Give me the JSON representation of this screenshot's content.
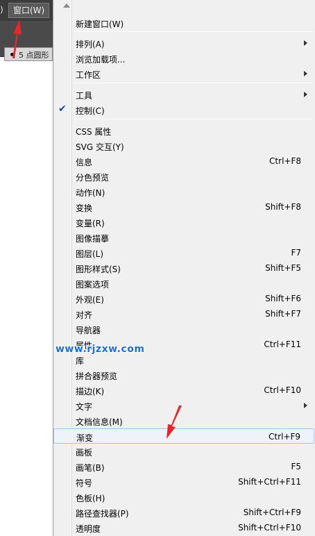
{
  "menubar": {
    "left_fragment": ")",
    "window_menu_label": "窗口(W)"
  },
  "toolbar": {
    "brush_label": "5 点圆形"
  },
  "menu": {
    "items": [
      {
        "label": "新建窗口(W)",
        "shortcut": "",
        "submenu": false
      },
      {
        "label": "排列(A)",
        "shortcut": "",
        "submenu": true
      },
      {
        "label": "浏览加载项...",
        "shortcut": "",
        "submenu": false
      },
      {
        "label": "工作区",
        "shortcut": "",
        "submenu": true
      },
      {
        "label": "工具",
        "shortcut": "",
        "submenu": true
      },
      {
        "label": "控制(C)",
        "shortcut": "",
        "submenu": false,
        "checked": true
      },
      {
        "label": "CSS 属性",
        "shortcut": "",
        "submenu": false
      },
      {
        "label": "SVG 交互(Y)",
        "shortcut": "",
        "submenu": false
      },
      {
        "label": "信息",
        "shortcut": "Ctrl+F8",
        "submenu": false
      },
      {
        "label": "分色预览",
        "shortcut": "",
        "submenu": false
      },
      {
        "label": "动作(N)",
        "shortcut": "",
        "submenu": false
      },
      {
        "label": "变换",
        "shortcut": "Shift+F8",
        "submenu": false
      },
      {
        "label": "变量(R)",
        "shortcut": "",
        "submenu": false
      },
      {
        "label": "图像描摹",
        "shortcut": "",
        "submenu": false
      },
      {
        "label": "图层(L)",
        "shortcut": "F7",
        "submenu": false
      },
      {
        "label": "图形样式(S)",
        "shortcut": "Shift+F5",
        "submenu": false
      },
      {
        "label": "图案选项",
        "shortcut": "",
        "submenu": false
      },
      {
        "label": "外观(E)",
        "shortcut": "Shift+F6",
        "submenu": false
      },
      {
        "label": "对齐",
        "shortcut": "Shift+F7",
        "submenu": false
      },
      {
        "label": "导航器",
        "shortcut": "",
        "submenu": false
      },
      {
        "label": "属性",
        "shortcut": "Ctrl+F11",
        "submenu": false
      },
      {
        "label": "库",
        "shortcut": "",
        "submenu": false
      },
      {
        "label": "拼合器预览",
        "shortcut": "",
        "submenu": false
      },
      {
        "label": "描边(K)",
        "shortcut": "Ctrl+F10",
        "submenu": false
      },
      {
        "label": "文字",
        "shortcut": "",
        "submenu": true
      },
      {
        "label": "文档信息(M)",
        "shortcut": "",
        "submenu": false
      },
      {
        "label": "渐变",
        "shortcut": "Ctrl+F9",
        "submenu": false,
        "highlighted": true
      },
      {
        "label": "画板",
        "shortcut": "",
        "submenu": false
      },
      {
        "label": "画笔(B)",
        "shortcut": "F5",
        "submenu": false
      },
      {
        "label": "符号",
        "shortcut": "Shift+Ctrl+F11",
        "submenu": false
      },
      {
        "label": "色板(H)",
        "shortcut": "",
        "submenu": false
      },
      {
        "label": "路径查找器(P)",
        "shortcut": "Shift+Ctrl+F9",
        "submenu": false
      },
      {
        "label": "透明度",
        "shortcut": "Shift+Ctrl+F10",
        "submenu": false
      }
    ]
  },
  "watermark": {
    "text": "www.rjzxw.com"
  },
  "colors": {
    "highlight_bg": "#eef3fb",
    "highlight_border": "#a9c3e6",
    "check": "#1a3fbf",
    "annotation_arrow": "#e8252b",
    "watermark": "#1c6fd6"
  },
  "icons": {
    "checkmark": "check-icon",
    "submenu": "chevron-right-icon",
    "scroll_up": "scroll-up-icon"
  }
}
